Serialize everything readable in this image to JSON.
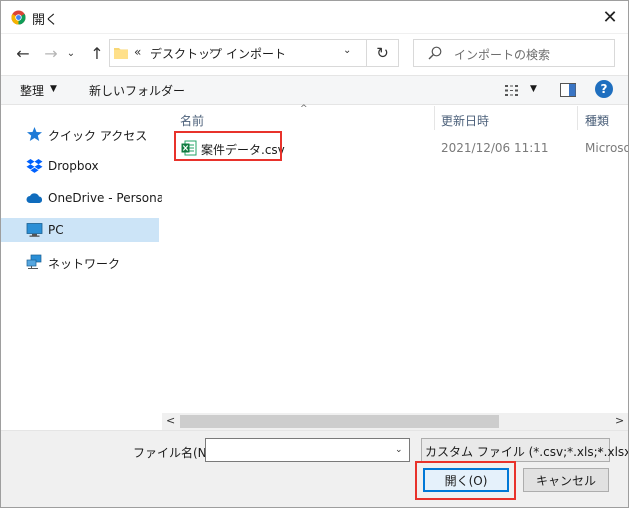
{
  "window": {
    "title": "開く",
    "close_glyph": "✕"
  },
  "navigation": {
    "back_glyph": "←",
    "forward_glyph": "→",
    "recent_glyph": "⌄",
    "up_glyph": "↑",
    "refresh_glyph": "↻"
  },
  "address": {
    "chevron": "«",
    "segment_1": "デスクトップ",
    "separator": "›",
    "segment_2": "インポート",
    "dropdown_glyph": "⌄"
  },
  "search": {
    "placeholder": "インポートの検索"
  },
  "toolbar": {
    "organize_label": "整理",
    "organize_caret": "▼",
    "new_folder_label": "新しいフォルダー",
    "view_caret": "▼",
    "help_label": "?"
  },
  "sidebar": {
    "items": [
      {
        "label": "クイック アクセス",
        "icon": "star-icon"
      },
      {
        "label": "Dropbox",
        "icon": "dropbox-icon"
      },
      {
        "label": "OneDrive - Personal",
        "icon": "cloud-icon"
      },
      {
        "label": "PC",
        "icon": "computer-icon",
        "selected": true
      },
      {
        "label": "ネットワーク",
        "icon": "network-icon"
      }
    ]
  },
  "file_list": {
    "columns": {
      "name": "名前",
      "date": "更新日時",
      "type": "種類"
    },
    "sort_arrow": "^",
    "rows": [
      {
        "name": "案件データ.csv",
        "date": "2021/12/06 11:11",
        "type": "Microso",
        "icon": "excel-csv-icon"
      }
    ]
  },
  "scrollbar": {
    "left_glyph": "<",
    "right_glyph": ">"
  },
  "bottom": {
    "filename_label": "ファイル名(N):",
    "filename_value": "",
    "filename_caret": "⌄",
    "filetype_value": "カスタム ファイル (*.csv;*.xls;*.xlsx)",
    "filetype_caret": "⌄",
    "open_label": "開く(O)",
    "cancel_label": "キャンセル"
  },
  "colors": {
    "highlight_red": "#e8322b",
    "selection_blue": "#cce4f7",
    "accent_blue": "#0078d7"
  }
}
